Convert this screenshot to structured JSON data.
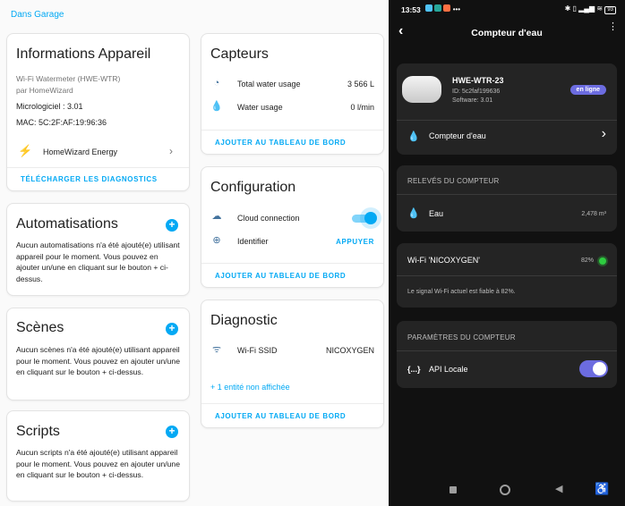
{
  "left": {
    "breadcrumb": "Dans Garage",
    "device_info": {
      "title": "Informations Appareil",
      "model": "Wi-Fi Watermeter (HWE-WTR)",
      "manufacturer": "par HomeWizard",
      "firmware": "Micrologiciel : 3.01",
      "mac": "MAC: 5C:2F:AF:19:96:36",
      "integration": "HomeWizard Energy",
      "download_diagnostics": "TÉLÉCHARGER LES DIAGNOSTICS"
    },
    "automations": {
      "title": "Automatisations",
      "empty_text": "Aucun automatisations n'a été ajouté(e) utilisant appareil pour le moment. Vous pouvez en ajouter un/une en cliquant sur le bouton + ci-dessus."
    },
    "scenes": {
      "title": "Scènes",
      "empty_text": "Aucun scènes n'a été ajouté(e) utilisant appareil pour le moment. Vous pouvez en ajouter un/une en cliquant sur le bouton + ci-dessus."
    },
    "scripts": {
      "title": "Scripts",
      "empty_text": "Aucun scripts n'a été ajouté(e) utilisant appareil pour le moment. Vous pouvez en ajouter un/une en cliquant sur le bouton + ci-dessus."
    },
    "sensors": {
      "title": "Capteurs",
      "rows": [
        {
          "label": "Total water usage",
          "value": "3 566 L"
        },
        {
          "label": "Water usage",
          "value": "0 l/min"
        }
      ],
      "add_to_dashboard": "AJOUTER AU TABLEAU DE BORD"
    },
    "configuration": {
      "title": "Configuration",
      "cloud_label": "Cloud connection",
      "cloud_enabled": true,
      "identify_label": "Identifier",
      "identify_action": "APPUYER",
      "add_to_dashboard": "AJOUTER AU TABLEAU DE BORD"
    },
    "diagnostic": {
      "title": "Diagnostic",
      "ssid_label": "Wi-Fi SSID",
      "ssid_value": "NICOXYGEN",
      "hidden_entities": "+ 1 entité non affichée",
      "add_to_dashboard": "AJOUTER AU TABLEAU DE BORD"
    }
  },
  "right": {
    "status_time": "13:53",
    "battery": "93",
    "header_title": "Compteur d'eau",
    "device": {
      "name": "HWE-WTR-23",
      "id": "ID: 5c2faf199636",
      "software": "Software: 3.01",
      "badge": "en ligne",
      "link_label": "Compteur d'eau"
    },
    "readings": {
      "section": "RELEVÉS DU COMPTEUR",
      "label": "Eau",
      "value": "2,478 m³"
    },
    "wifi": {
      "label": "Wi-Fi 'NICOXYGEN'",
      "percent": "82%",
      "note": "Le signal Wi-Fi actuel est fiable à 82%."
    },
    "settings": {
      "section": "PARAMÈTRES DU COMPTEUR",
      "api_icon": "{...}",
      "api_label": "API Locale",
      "api_enabled": true
    }
  },
  "colors": {
    "ha_accent": "#03a9f4",
    "ha_icon": "#44739e",
    "phone_badge": "#6c6ce0",
    "wifi_ok": "#2ecc40"
  }
}
